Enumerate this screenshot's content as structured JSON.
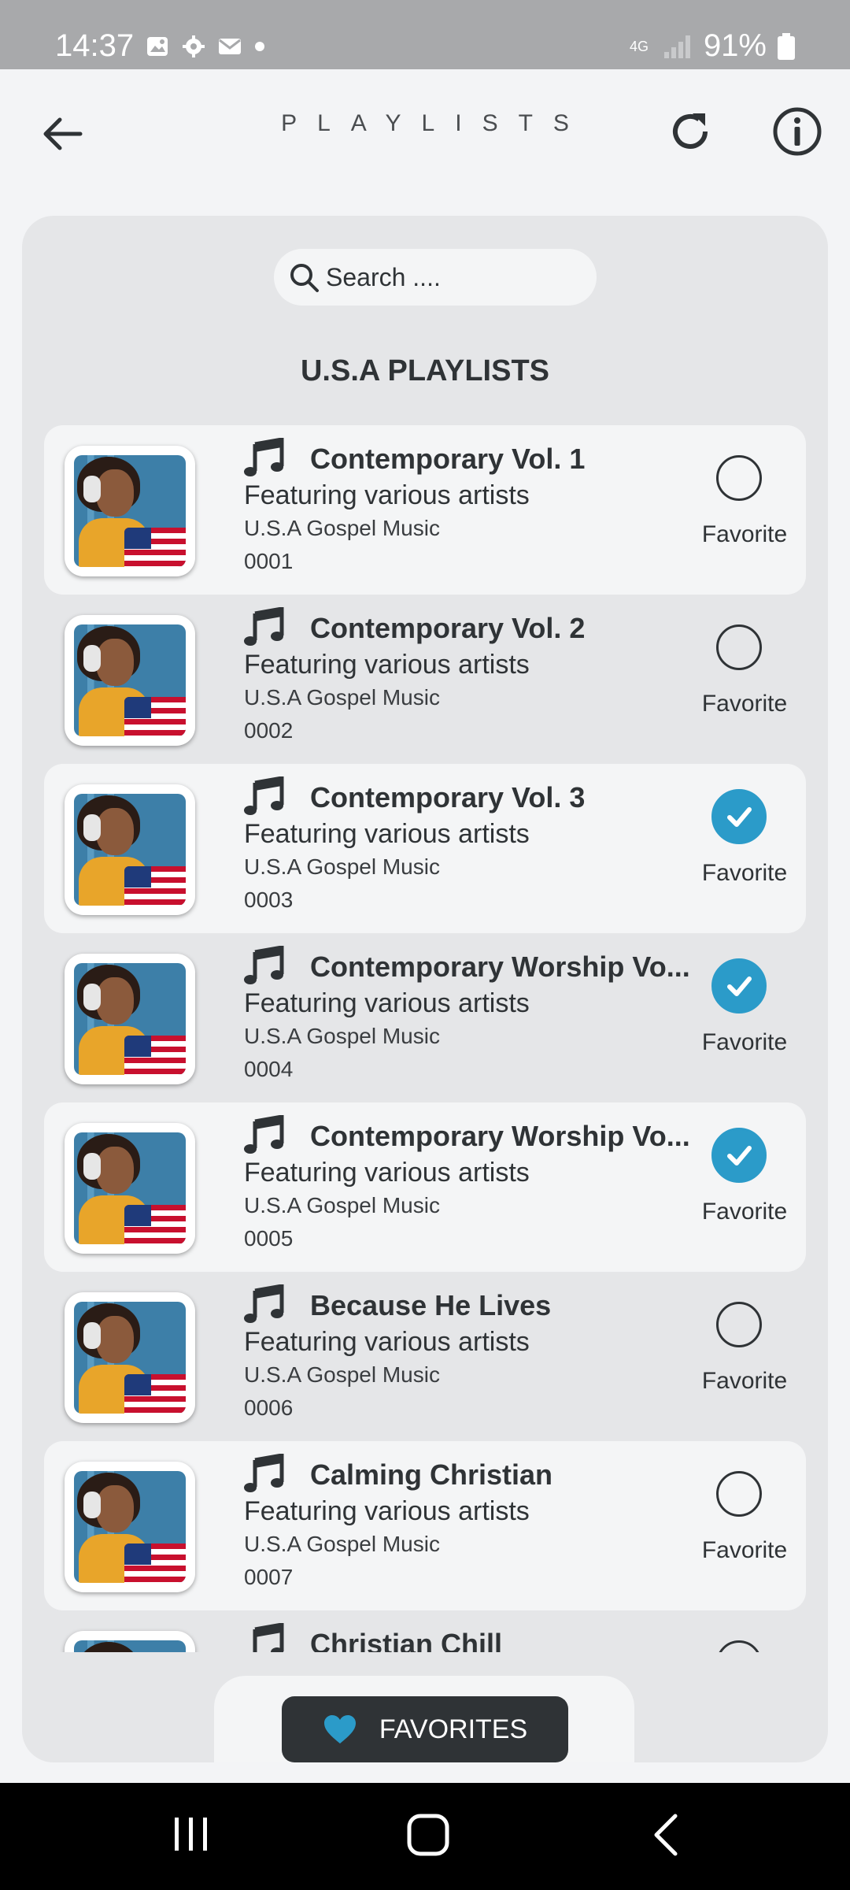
{
  "status_bar": {
    "time": "14:37",
    "network": "4G",
    "battery": "91%"
  },
  "header": {
    "title": "PLAYLISTS"
  },
  "search": {
    "placeholder": "Search ...."
  },
  "section_title": "U.S.A PLAYLISTS",
  "playlists": [
    {
      "title": "Contemporary Vol. 1",
      "subtitle": "Featuring various artists",
      "genre": "U.S.A Gospel Music",
      "id": "0001",
      "favorite": false,
      "favorite_label": "Favorite"
    },
    {
      "title": "Contemporary Vol. 2",
      "subtitle": "Featuring various artists",
      "genre": "U.S.A Gospel Music",
      "id": "0002",
      "favorite": false,
      "favorite_label": "Favorite"
    },
    {
      "title": "Contemporary Vol. 3",
      "subtitle": "Featuring various artists",
      "genre": "U.S.A Gospel Music",
      "id": "0003",
      "favorite": true,
      "favorite_label": "Favorite"
    },
    {
      "title": "Contemporary Worship Vo...",
      "subtitle": "Featuring various artists",
      "genre": "U.S.A Gospel Music",
      "id": "0004",
      "favorite": true,
      "favorite_label": "Favorite"
    },
    {
      "title": "Contemporary Worship Vo...",
      "subtitle": "Featuring various artists",
      "genre": "U.S.A Gospel Music",
      "id": "0005",
      "favorite": true,
      "favorite_label": "Favorite"
    },
    {
      "title": "Because He Lives",
      "subtitle": "Featuring various artists",
      "genre": "U.S.A Gospel Music",
      "id": "0006",
      "favorite": false,
      "favorite_label": "Favorite"
    },
    {
      "title": "Calming Christian",
      "subtitle": "Featuring various artists",
      "genre": "U.S.A Gospel Music",
      "id": "0007",
      "favorite": false,
      "favorite_label": "Favorite"
    },
    {
      "title": "Christian Chill",
      "subtitle": "",
      "genre": "",
      "id": "",
      "favorite": false,
      "favorite_label": ""
    }
  ],
  "favorites_button": {
    "label": "FAVORITES",
    "icon": "heart-icon"
  },
  "colors": {
    "accent": "#2b9bc9",
    "dark": "#2f3336",
    "panel": "#e5e6e8",
    "row_alt": "#f4f5f6"
  }
}
